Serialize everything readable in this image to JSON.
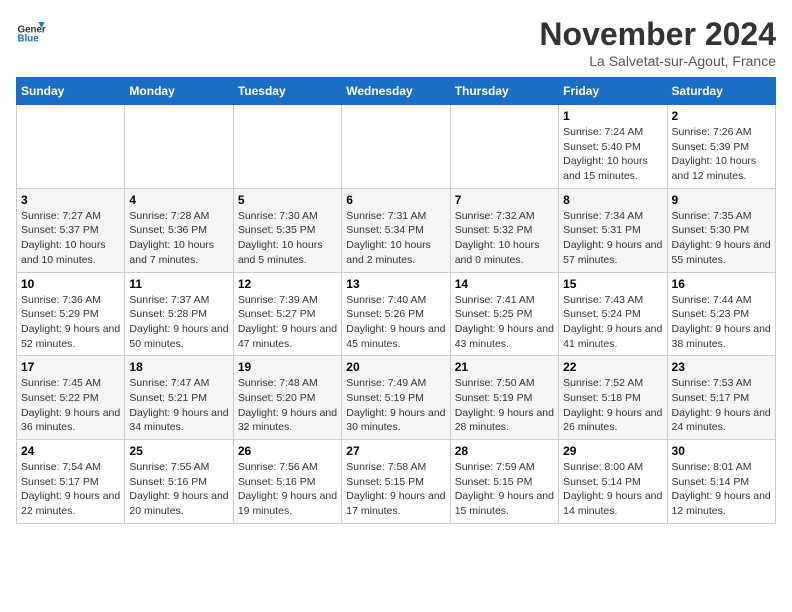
{
  "header": {
    "logo_general": "General",
    "logo_blue": "Blue",
    "month": "November 2024",
    "location": "La Salvetat-sur-Agout, France"
  },
  "weekdays": [
    "Sunday",
    "Monday",
    "Tuesday",
    "Wednesday",
    "Thursday",
    "Friday",
    "Saturday"
  ],
  "weeks": [
    [
      {
        "day": "",
        "info": ""
      },
      {
        "day": "",
        "info": ""
      },
      {
        "day": "",
        "info": ""
      },
      {
        "day": "",
        "info": ""
      },
      {
        "day": "",
        "info": ""
      },
      {
        "day": "1",
        "info": "Sunrise: 7:24 AM\nSunset: 5:40 PM\nDaylight: 10 hours and 15 minutes."
      },
      {
        "day": "2",
        "info": "Sunrise: 7:26 AM\nSunset: 5:39 PM\nDaylight: 10 hours and 12 minutes."
      }
    ],
    [
      {
        "day": "3",
        "info": "Sunrise: 7:27 AM\nSunset: 5:37 PM\nDaylight: 10 hours and 10 minutes."
      },
      {
        "day": "4",
        "info": "Sunrise: 7:28 AM\nSunset: 5:36 PM\nDaylight: 10 hours and 7 minutes."
      },
      {
        "day": "5",
        "info": "Sunrise: 7:30 AM\nSunset: 5:35 PM\nDaylight: 10 hours and 5 minutes."
      },
      {
        "day": "6",
        "info": "Sunrise: 7:31 AM\nSunset: 5:34 PM\nDaylight: 10 hours and 2 minutes."
      },
      {
        "day": "7",
        "info": "Sunrise: 7:32 AM\nSunset: 5:32 PM\nDaylight: 10 hours and 0 minutes."
      },
      {
        "day": "8",
        "info": "Sunrise: 7:34 AM\nSunset: 5:31 PM\nDaylight: 9 hours and 57 minutes."
      },
      {
        "day": "9",
        "info": "Sunrise: 7:35 AM\nSunset: 5:30 PM\nDaylight: 9 hours and 55 minutes."
      }
    ],
    [
      {
        "day": "10",
        "info": "Sunrise: 7:36 AM\nSunset: 5:29 PM\nDaylight: 9 hours and 52 minutes."
      },
      {
        "day": "11",
        "info": "Sunrise: 7:37 AM\nSunset: 5:28 PM\nDaylight: 9 hours and 50 minutes."
      },
      {
        "day": "12",
        "info": "Sunrise: 7:39 AM\nSunset: 5:27 PM\nDaylight: 9 hours and 47 minutes."
      },
      {
        "day": "13",
        "info": "Sunrise: 7:40 AM\nSunset: 5:26 PM\nDaylight: 9 hours and 45 minutes."
      },
      {
        "day": "14",
        "info": "Sunrise: 7:41 AM\nSunset: 5:25 PM\nDaylight: 9 hours and 43 minutes."
      },
      {
        "day": "15",
        "info": "Sunrise: 7:43 AM\nSunset: 5:24 PM\nDaylight: 9 hours and 41 minutes."
      },
      {
        "day": "16",
        "info": "Sunrise: 7:44 AM\nSunset: 5:23 PM\nDaylight: 9 hours and 38 minutes."
      }
    ],
    [
      {
        "day": "17",
        "info": "Sunrise: 7:45 AM\nSunset: 5:22 PM\nDaylight: 9 hours and 36 minutes."
      },
      {
        "day": "18",
        "info": "Sunrise: 7:47 AM\nSunset: 5:21 PM\nDaylight: 9 hours and 34 minutes."
      },
      {
        "day": "19",
        "info": "Sunrise: 7:48 AM\nSunset: 5:20 PM\nDaylight: 9 hours and 32 minutes."
      },
      {
        "day": "20",
        "info": "Sunrise: 7:49 AM\nSunset: 5:19 PM\nDaylight: 9 hours and 30 minutes."
      },
      {
        "day": "21",
        "info": "Sunrise: 7:50 AM\nSunset: 5:19 PM\nDaylight: 9 hours and 28 minutes."
      },
      {
        "day": "22",
        "info": "Sunrise: 7:52 AM\nSunset: 5:18 PM\nDaylight: 9 hours and 26 minutes."
      },
      {
        "day": "23",
        "info": "Sunrise: 7:53 AM\nSunset: 5:17 PM\nDaylight: 9 hours and 24 minutes."
      }
    ],
    [
      {
        "day": "24",
        "info": "Sunrise: 7:54 AM\nSunset: 5:17 PM\nDaylight: 9 hours and 22 minutes."
      },
      {
        "day": "25",
        "info": "Sunrise: 7:55 AM\nSunset: 5:16 PM\nDaylight: 9 hours and 20 minutes."
      },
      {
        "day": "26",
        "info": "Sunrise: 7:56 AM\nSunset: 5:16 PM\nDaylight: 9 hours and 19 minutes."
      },
      {
        "day": "27",
        "info": "Sunrise: 7:58 AM\nSunset: 5:15 PM\nDaylight: 9 hours and 17 minutes."
      },
      {
        "day": "28",
        "info": "Sunrise: 7:59 AM\nSunset: 5:15 PM\nDaylight: 9 hours and 15 minutes."
      },
      {
        "day": "29",
        "info": "Sunrise: 8:00 AM\nSunset: 5:14 PM\nDaylight: 9 hours and 14 minutes."
      },
      {
        "day": "30",
        "info": "Sunrise: 8:01 AM\nSunset: 5:14 PM\nDaylight: 9 hours and 12 minutes."
      }
    ]
  ]
}
